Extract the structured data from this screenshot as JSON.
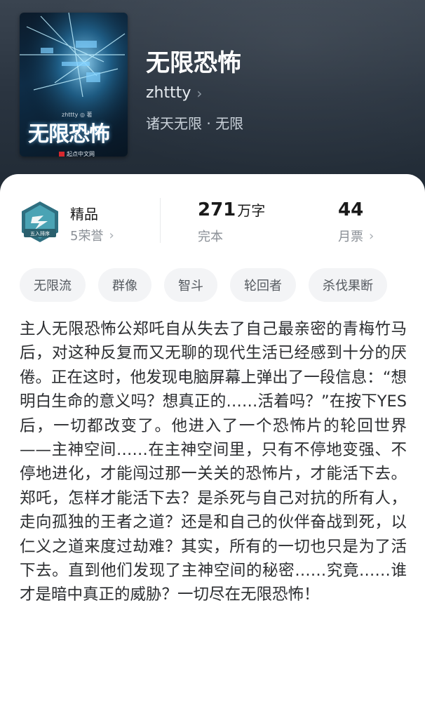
{
  "book": {
    "title": "无限恐怖",
    "author": "zhttty",
    "genre": "诸天无限 · 无限"
  },
  "cover": {
    "title": "无限恐怖",
    "author_line": "zhttty ◎ 著",
    "publisher": "起点中文网"
  },
  "stats": {
    "quality": {
      "label": "精品",
      "sub": "5荣誉",
      "badge_text": "五入排序"
    },
    "words": {
      "value": "271",
      "unit": "万字",
      "sub": "完本"
    },
    "tickets": {
      "value": "44",
      "sub": "月票"
    }
  },
  "tags": [
    "无限流",
    "群像",
    "智斗",
    "轮回者",
    "杀伐果断"
  ],
  "synopsis": "主人无限恐怖公郑吒自从失去了自己最亲密的青梅竹马后，对这种反复而又无聊的现代生活已经感到十分的厌倦。正在这时，他发现电脑屏幕上弹出了一段信息：“想明白生命的意义吗？想真正的……活着吗？”在按下YES后，一切都改变了。他进入了一个恐怖片的轮回世界——主神空间……在主神空间里，只有不停地变强、不停地进化，才能闯过那一关关的恐怖片，才能活下去。郑吒，怎样才能活下去？是杀死与自己对抗的所有人，走向孤独的王者之道？还是和自己的伙伴奋战到死，以仁义之道来度过劫难？其实，所有的一切也只是为了活下去。直到他们发现了主神空间的秘密……究竟……谁才是暗中真正的威胁？一切尽在无限恐怖！",
  "colors": {
    "hero_bg": "#2a3440",
    "badge_teal": "#3d8fa0",
    "tag_bg": "#f3f4f6"
  },
  "icons": {
    "author_chevron": "chevron-right-icon",
    "honor_badge": "honor-badge-icon"
  }
}
